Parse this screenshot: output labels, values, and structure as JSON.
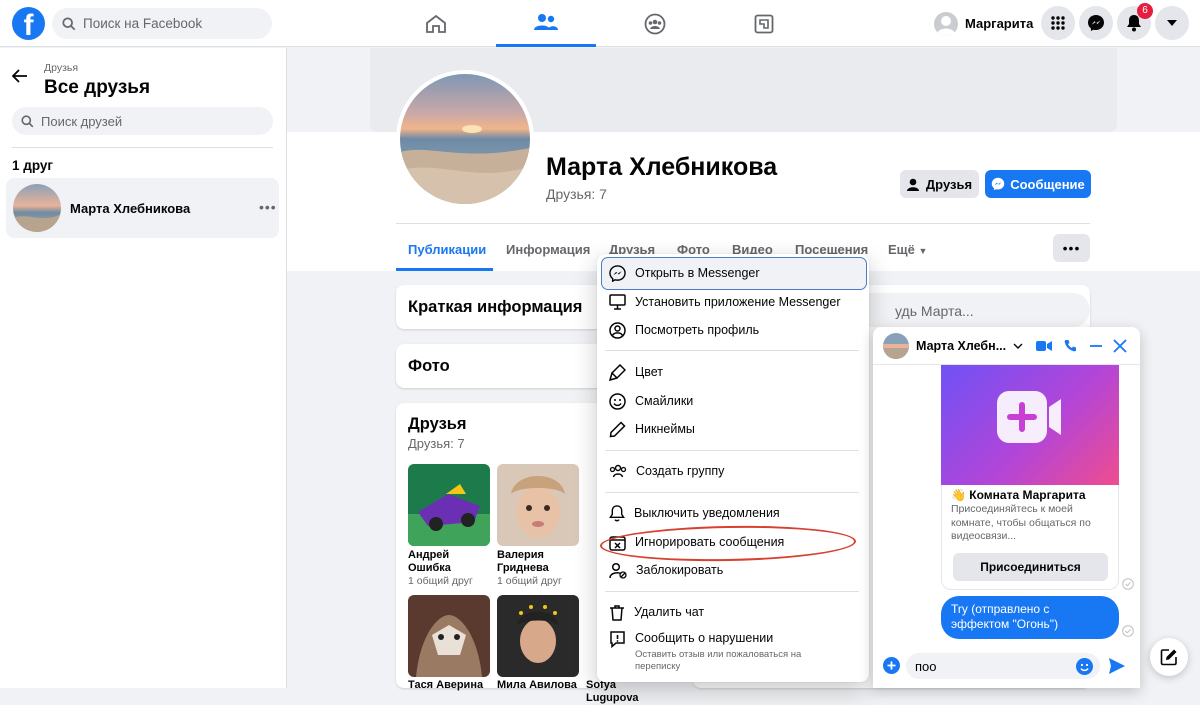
{
  "topbar": {
    "search_placeholder": "Поиск на Facebook",
    "profile_name": "Маргарита",
    "notifications_count": "6",
    "nav": [
      "home-icon",
      "friends-icon",
      "groups-icon",
      "gaming-icon"
    ]
  },
  "sidebar": {
    "breadcrumb": "Друзья",
    "title": "Все друзья",
    "search_placeholder": "Поиск друзей",
    "count_label": "1 друг",
    "friends": [
      {
        "name": "Марта Хлебникова"
      }
    ]
  },
  "profile": {
    "name": "Марта Хлебникова",
    "friends_count": "Друзья: 7",
    "friends_button": "Друзья",
    "message_button": "Сообщение",
    "tabs": [
      "Публикации",
      "Информация",
      "Друзья",
      "Фото",
      "Видео",
      "Посещения",
      "Ещё"
    ]
  },
  "cards": {
    "intro_title": "Краткая информация",
    "photos_title": "Фото",
    "friends_title": "Друзья",
    "friends_subtitle": "Друзья: 7",
    "friends": [
      {
        "name": "Андрей Ошибка",
        "mutual": "1 общий друг"
      },
      {
        "name": "Валерия Гриднева",
        "mutual": "1 общий друг"
      },
      {
        "name": "Тася Аверина",
        "mutual": ""
      },
      {
        "name": "Мила Авилова",
        "mutual": ""
      },
      {
        "name": "Sofya Lugupova",
        "mutual": ""
      }
    ],
    "post_placeholder": "удь Марта..."
  },
  "menu": {
    "items": [
      {
        "label": "Открыть в Messenger",
        "icon": "messenger-icon"
      },
      {
        "label": "Установить приложение Messenger",
        "icon": "monitor-icon"
      },
      {
        "label": "Посмотреть профиль",
        "icon": "profile-icon"
      },
      {
        "label": "Цвет",
        "icon": "paint-icon"
      },
      {
        "label": "Смайлики",
        "icon": "smile-icon"
      },
      {
        "label": "Никнеймы",
        "icon": "pencil-icon"
      },
      {
        "label": "Создать группу",
        "icon": "group-icon"
      },
      {
        "label": "Выключить уведомления",
        "icon": "bell-icon"
      },
      {
        "label": "Игнорировать сообщения",
        "icon": "ignore-icon"
      },
      {
        "label": "Заблокировать",
        "icon": "block-user-icon"
      },
      {
        "label": "Удалить чат",
        "icon": "trash-icon"
      },
      {
        "label": "Сообщить о нарушении",
        "icon": "report-icon",
        "sub": "Оставить отзыв или пожаловаться на переписку"
      }
    ]
  },
  "chat": {
    "name": "Марта Хлебн...",
    "room_title": "👋 Комната Маргарита",
    "room_desc": "Присоединяйтесь к моей комнате, чтобы общаться по видеосвязи...",
    "join_button": "Присоединиться",
    "bubble": "Try (отправлено с эффектом \"Огонь\")",
    "input_value": "поо"
  },
  "colors": {
    "accent": "#1877f2",
    "highlight_oval": "#d8402f"
  }
}
